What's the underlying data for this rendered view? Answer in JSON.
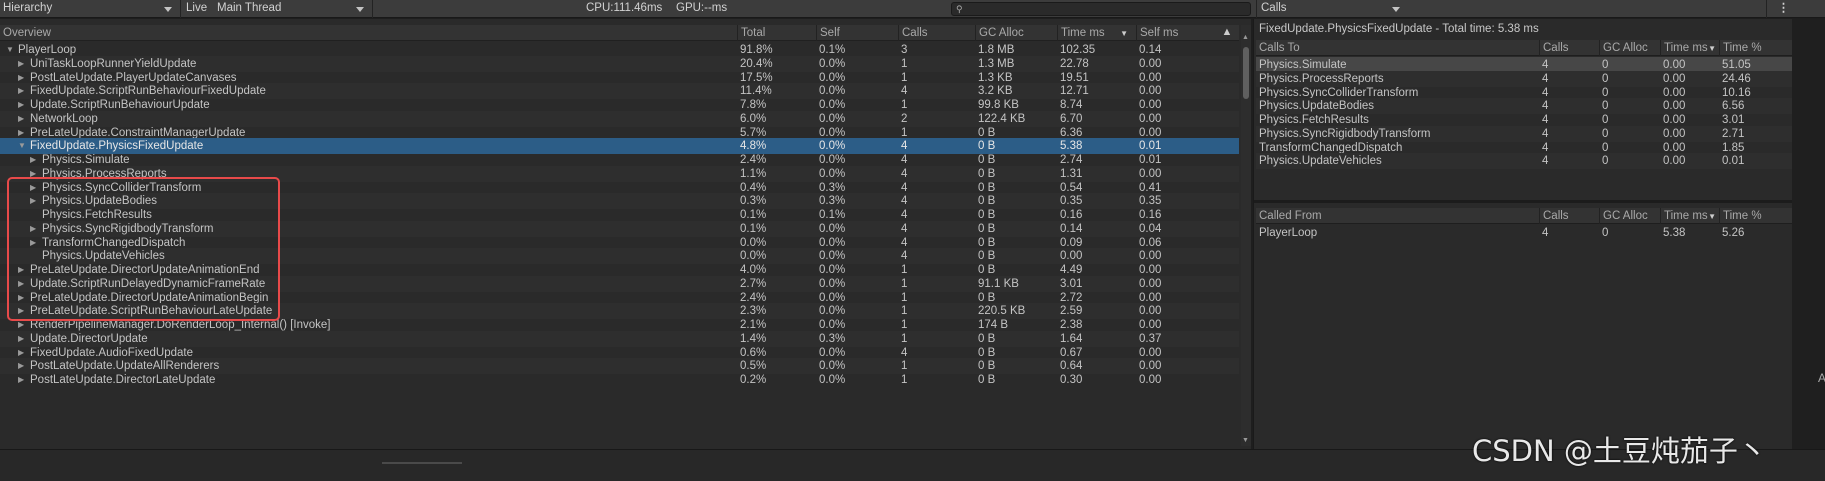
{
  "toolbar": {
    "view_mode": "Hierarchy",
    "live_label": "Live",
    "thread": "Main Thread",
    "cpu": "CPU:111.46ms",
    "gpu": "GPU:--ms",
    "search_icon": "search-icon",
    "right_mode": "Calls",
    "menu_icon": "kebab-menu-icon"
  },
  "left": {
    "columns": [
      "Overview",
      "Total",
      "Self",
      "Calls",
      "GC Alloc",
      "Time ms",
      "Self ms"
    ],
    "sorted_column": "Time ms",
    "rows": [
      {
        "name": "PlayerLoop",
        "total": "91.8%",
        "self": "0.1%",
        "calls": "3",
        "gc": "1.8 MB",
        "time": "102.35",
        "selfms": "0.14",
        "depth": 0,
        "expander": "expanded"
      },
      {
        "name": "UniTaskLoopRunnerYieldUpdate",
        "total": "20.4%",
        "self": "0.0%",
        "calls": "1",
        "gc": "1.3 MB",
        "time": "22.78",
        "selfms": "0.00",
        "depth": 1,
        "expander": "collapsed"
      },
      {
        "name": "PostLateUpdate.PlayerUpdateCanvases",
        "total": "17.5%",
        "self": "0.0%",
        "calls": "1",
        "gc": "1.3 KB",
        "time": "19.51",
        "selfms": "0.00",
        "depth": 1,
        "expander": "collapsed"
      },
      {
        "name": "FixedUpdate.ScriptRunBehaviourFixedUpdate",
        "total": "11.4%",
        "self": "0.0%",
        "calls": "4",
        "gc": "3.2 KB",
        "time": "12.71",
        "selfms": "0.00",
        "depth": 1,
        "expander": "collapsed"
      },
      {
        "name": "Update.ScriptRunBehaviourUpdate",
        "total": "7.8%",
        "self": "0.0%",
        "calls": "1",
        "gc": "99.8 KB",
        "time": "8.74",
        "selfms": "0.00",
        "depth": 1,
        "expander": "collapsed"
      },
      {
        "name": "NetworkLoop",
        "total": "6.0%",
        "self": "0.0%",
        "calls": "2",
        "gc": "122.4 KB",
        "time": "6.70",
        "selfms": "0.00",
        "depth": 1,
        "expander": "collapsed"
      },
      {
        "name": "PreLateUpdate.ConstraintManagerUpdate",
        "total": "5.7%",
        "self": "0.0%",
        "calls": "1",
        "gc": "0 B",
        "time": "6.36",
        "selfms": "0.00",
        "depth": 1,
        "expander": "collapsed"
      },
      {
        "name": "FixedUpdate.PhysicsFixedUpdate",
        "total": "4.8%",
        "self": "0.0%",
        "calls": "4",
        "gc": "0 B",
        "time": "5.38",
        "selfms": "0.01",
        "depth": 1,
        "expander": "expanded",
        "selected": true
      },
      {
        "name": "Physics.Simulate",
        "total": "2.4%",
        "self": "0.0%",
        "calls": "4",
        "gc": "0 B",
        "time": "2.74",
        "selfms": "0.01",
        "depth": 2,
        "expander": "collapsed"
      },
      {
        "name": "Physics.ProcessReports",
        "total": "1.1%",
        "self": "0.0%",
        "calls": "4",
        "gc": "0 B",
        "time": "1.31",
        "selfms": "0.00",
        "depth": 2,
        "expander": "collapsed"
      },
      {
        "name": "Physics.SyncColliderTransform",
        "total": "0.4%",
        "self": "0.3%",
        "calls": "4",
        "gc": "0 B",
        "time": "0.54",
        "selfms": "0.41",
        "depth": 2,
        "expander": "collapsed"
      },
      {
        "name": "Physics.UpdateBodies",
        "total": "0.3%",
        "self": "0.3%",
        "calls": "4",
        "gc": "0 B",
        "time": "0.35",
        "selfms": "0.35",
        "depth": 2,
        "expander": "collapsed"
      },
      {
        "name": "Physics.FetchResults",
        "total": "0.1%",
        "self": "0.1%",
        "calls": "4",
        "gc": "0 B",
        "time": "0.16",
        "selfms": "0.16",
        "depth": 2,
        "expander": "none"
      },
      {
        "name": "Physics.SyncRigidbodyTransform",
        "total": "0.1%",
        "self": "0.0%",
        "calls": "4",
        "gc": "0 B",
        "time": "0.14",
        "selfms": "0.04",
        "depth": 2,
        "expander": "collapsed"
      },
      {
        "name": "TransformChangedDispatch",
        "total": "0.0%",
        "self": "0.0%",
        "calls": "4",
        "gc": "0 B",
        "time": "0.09",
        "selfms": "0.06",
        "depth": 2,
        "expander": "collapsed"
      },
      {
        "name": "Physics.UpdateVehicles",
        "total": "0.0%",
        "self": "0.0%",
        "calls": "4",
        "gc": "0 B",
        "time": "0.00",
        "selfms": "0.00",
        "depth": 2,
        "expander": "none"
      },
      {
        "name": "PreLateUpdate.DirectorUpdateAnimationEnd",
        "total": "4.0%",
        "self": "0.0%",
        "calls": "1",
        "gc": "0 B",
        "time": "4.49",
        "selfms": "0.00",
        "depth": 1,
        "expander": "collapsed"
      },
      {
        "name": "Update.ScriptRunDelayedDynamicFrameRate",
        "total": "2.7%",
        "self": "0.0%",
        "calls": "1",
        "gc": "91.1 KB",
        "time": "3.01",
        "selfms": "0.00",
        "depth": 1,
        "expander": "collapsed"
      },
      {
        "name": "PreLateUpdate.DirectorUpdateAnimationBegin",
        "total": "2.4%",
        "self": "0.0%",
        "calls": "1",
        "gc": "0 B",
        "time": "2.72",
        "selfms": "0.00",
        "depth": 1,
        "expander": "collapsed"
      },
      {
        "name": "PreLateUpdate.ScriptRunBehaviourLateUpdate",
        "total": "2.3%",
        "self": "0.0%",
        "calls": "1",
        "gc": "220.5 KB",
        "time": "2.59",
        "selfms": "0.00",
        "depth": 1,
        "expander": "collapsed"
      },
      {
        "name": "RenderPipelineManager.DoRenderLoop_Internal() [Invoke]",
        "total": "2.1%",
        "self": "0.0%",
        "calls": "1",
        "gc": "174 B",
        "time": "2.38",
        "selfms": "0.00",
        "depth": 1,
        "expander": "collapsed"
      },
      {
        "name": "Update.DirectorUpdate",
        "total": "1.4%",
        "self": "0.3%",
        "calls": "1",
        "gc": "0 B",
        "time": "1.64",
        "selfms": "0.37",
        "depth": 1,
        "expander": "collapsed"
      },
      {
        "name": "FixedUpdate.AudioFixedUpdate",
        "total": "0.6%",
        "self": "0.0%",
        "calls": "4",
        "gc": "0 B",
        "time": "0.67",
        "selfms": "0.00",
        "depth": 1,
        "expander": "collapsed"
      },
      {
        "name": "PostLateUpdate.UpdateAllRenderers",
        "total": "0.5%",
        "self": "0.0%",
        "calls": "1",
        "gc": "0 B",
        "time": "0.64",
        "selfms": "0.00",
        "depth": 1,
        "expander": "collapsed"
      },
      {
        "name": "PostLateUpdate.DirectorLateUpdate",
        "total": "0.2%",
        "self": "0.0%",
        "calls": "1",
        "gc": "0 B",
        "time": "0.30",
        "selfms": "0.00",
        "depth": 1,
        "expander": "collapsed"
      }
    ]
  },
  "right": {
    "title": "FixedUpdate.PhysicsFixedUpdate - Total time: 5.38 ms",
    "calls_to": {
      "columns": [
        "Calls To",
        "Calls",
        "GC Alloc",
        "Time ms",
        "Time %"
      ],
      "rows": [
        {
          "name": "Physics.Simulate",
          "calls": "4",
          "gc": "0",
          "time": "0.00",
          "pct": "51.05",
          "selected": true
        },
        {
          "name": "Physics.ProcessReports",
          "calls": "4",
          "gc": "0",
          "time": "0.00",
          "pct": "24.46"
        },
        {
          "name": "Physics.SyncColliderTransform",
          "calls": "4",
          "gc": "0",
          "time": "0.00",
          "pct": "10.16"
        },
        {
          "name": "Physics.UpdateBodies",
          "calls": "4",
          "gc": "0",
          "time": "0.00",
          "pct": "6.56"
        },
        {
          "name": "Physics.FetchResults",
          "calls": "4",
          "gc": "0",
          "time": "0.00",
          "pct": "3.01"
        },
        {
          "name": "Physics.SyncRigidbodyTransform",
          "calls": "4",
          "gc": "0",
          "time": "0.00",
          "pct": "2.71"
        },
        {
          "name": "TransformChangedDispatch",
          "calls": "4",
          "gc": "0",
          "time": "0.00",
          "pct": "1.85"
        },
        {
          "name": "Physics.UpdateVehicles",
          "calls": "4",
          "gc": "0",
          "time": "0.00",
          "pct": "0.01"
        }
      ]
    },
    "called_from": {
      "columns": [
        "Called From",
        "Calls",
        "GC Alloc",
        "Time ms",
        "Time %"
      ],
      "rows": [
        {
          "name": "PlayerLoop",
          "calls": "4",
          "gc": "0",
          "time": "5.38",
          "pct": "5.26"
        }
      ]
    }
  },
  "watermark": "CSDN @土豆炖茄子丶",
  "colors": {
    "selection": "#2c5d87",
    "highlight_box": "#e84a4a",
    "panel_bg": "#2a2a2a"
  }
}
